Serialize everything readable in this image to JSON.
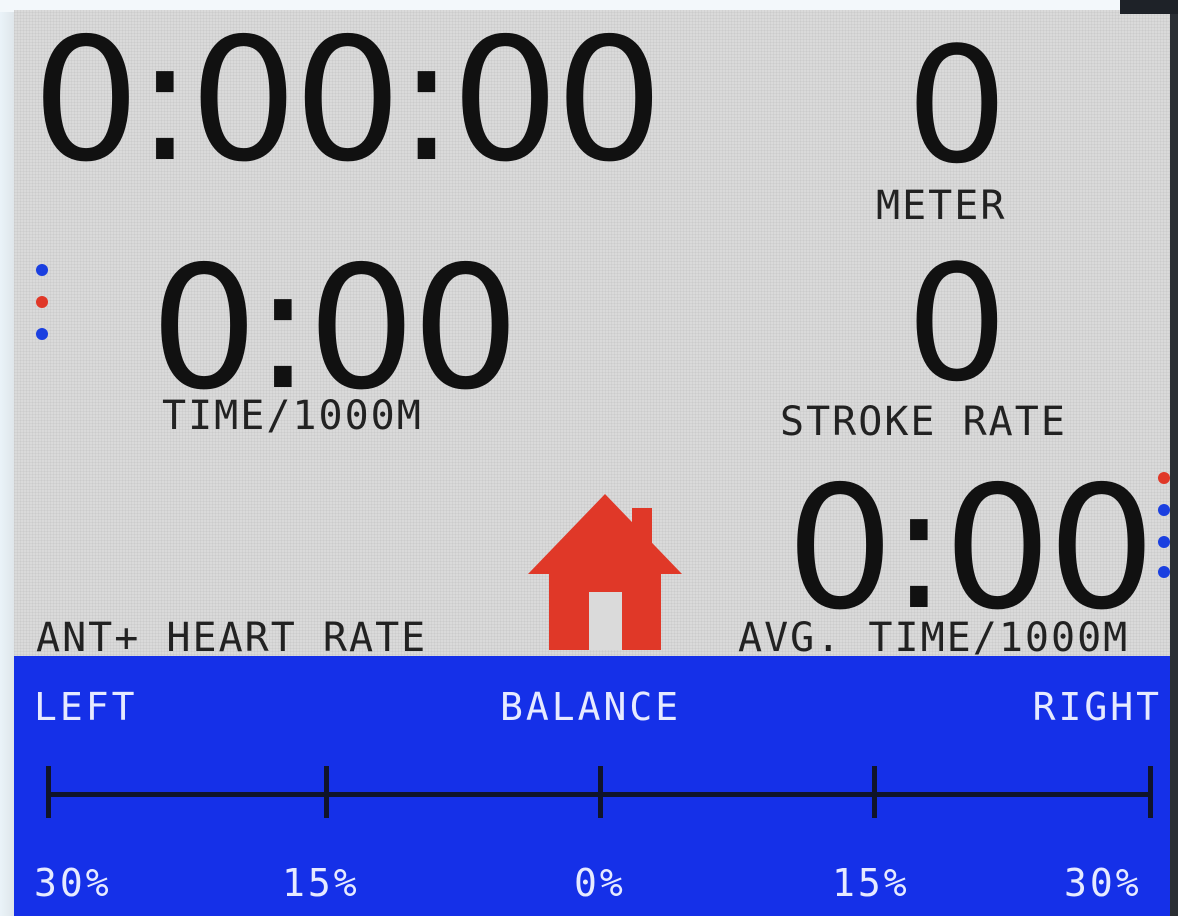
{
  "colors": {
    "screen_bg": "#dadada",
    "text": "#111111",
    "balance_bg": "#1530e8",
    "balance_text": "#e6eaff",
    "dot_blue": "#1a3fe0",
    "dot_red": "#e03828",
    "home_icon": "#e03828"
  },
  "metrics": {
    "total_time": "0:00:00",
    "meter": {
      "value": "0",
      "label": "METER"
    },
    "split": {
      "value": "0:00",
      "label": "TIME/1000M"
    },
    "stroke_rate": {
      "value": "0",
      "label": "STROKE RATE"
    },
    "avg_split": {
      "value": "0:00",
      "label": "AVG. TIME/1000M"
    },
    "heart_rate": {
      "label": "ANT+ HEART RATE"
    }
  },
  "indicators": {
    "left": [
      "blue",
      "red",
      "blue"
    ],
    "right": [
      "red",
      "blue",
      "blue",
      "blue"
    ]
  },
  "home": {
    "icon": "home-icon"
  },
  "balance": {
    "left_label": "LEFT",
    "title": "BALANCE",
    "right_label": "RIGHT",
    "scale": [
      "30%",
      "15%",
      "0%",
      "15%",
      "30%"
    ]
  }
}
